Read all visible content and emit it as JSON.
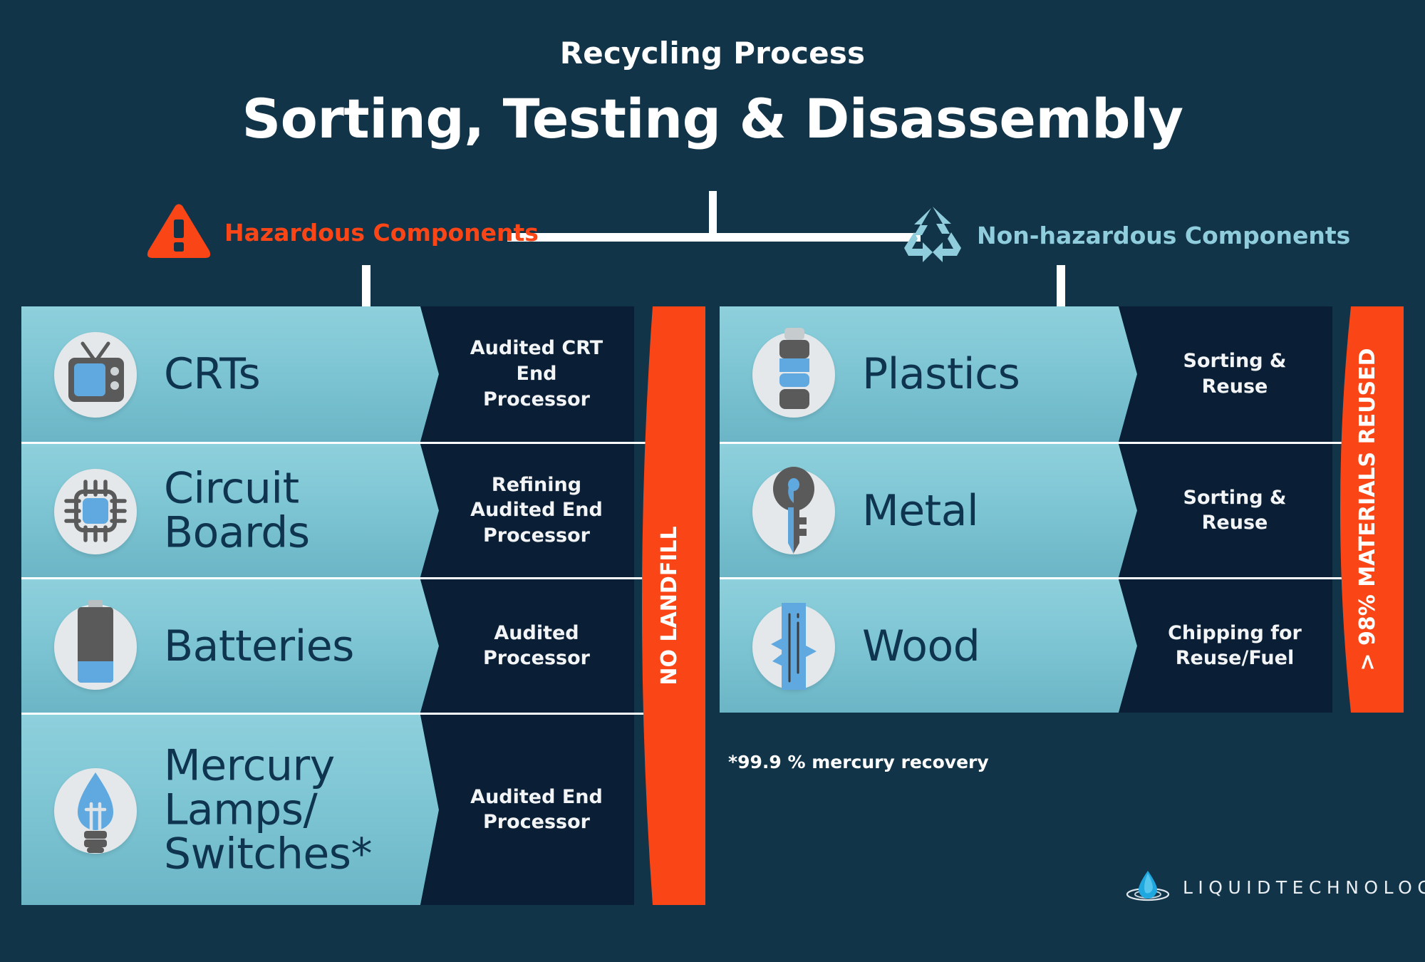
{
  "header": {
    "kicker": "Recycling Process",
    "title": "Sorting, Testing & Disassembly"
  },
  "categories": {
    "hazardous": {
      "label": "Hazardous Components",
      "icon": "warning-triangle-icon",
      "color": "#fa4616"
    },
    "non_hazardous": {
      "label": "Non-hazardous Components",
      "icon": "recycle-icon",
      "color": "#8fcddc"
    }
  },
  "colors": {
    "background": "#123449",
    "orange": "#fa4616",
    "teal": "#7bc3d2",
    "dark_panel": "#0a1f35",
    "label_text": "#0f3450"
  },
  "left_panel": {
    "strip_label": "NO LANDFILL",
    "rows": [
      {
        "name": "CRTs",
        "icon": "crt-television-icon",
        "process": "Audited CRT\nEnd\nProcessor"
      },
      {
        "name": "Circuit\nBoards",
        "icon": "microchip-icon",
        "process": "Refining\nAudited End\nProcessor"
      },
      {
        "name": "Batteries",
        "icon": "battery-icon",
        "process": "Audited\nProcessor"
      },
      {
        "name": "Mercury\nLamps/\nSwitches*",
        "icon": "light-bulb-icon",
        "process": "Audited End\nProcessor"
      }
    ]
  },
  "right_panel": {
    "strip_label": "> 98% MATERIALS REUSED",
    "rows": [
      {
        "name": "Plastics",
        "icon": "plastic-bottle-icon",
        "process": "Sorting &\nReuse"
      },
      {
        "name": "Metal",
        "icon": "key-icon",
        "process": "Sorting &\nReuse"
      },
      {
        "name": "Wood",
        "icon": "wood-plank-icon",
        "process": "Chipping for\nReuse/Fuel"
      }
    ]
  },
  "footnote": "*99.9 % mercury recovery",
  "logo": {
    "word": "LIQUIDTECHNOLOGY",
    "icon": "water-drop-icon"
  }
}
